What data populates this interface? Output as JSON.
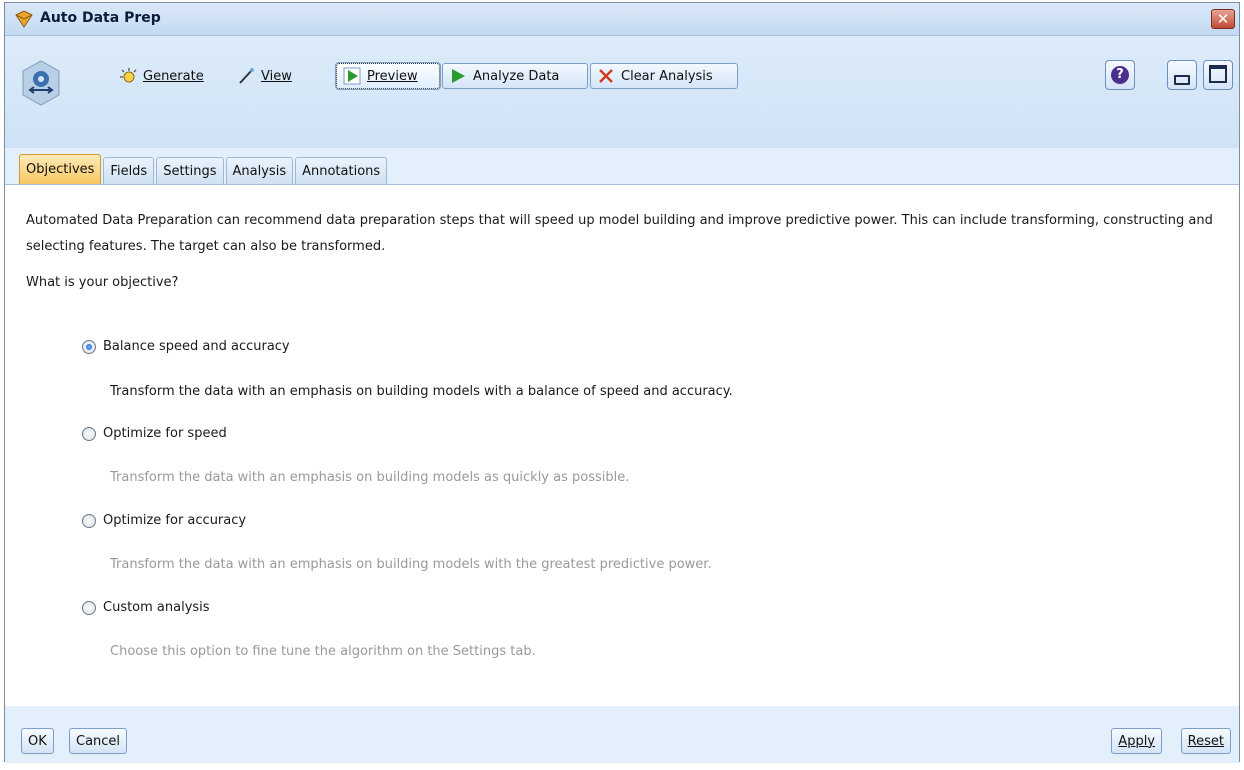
{
  "window": {
    "title": "Auto Data Prep",
    "close_glyph": "✕"
  },
  "toolbar": {
    "generate_label": "Generate",
    "view_label": "View",
    "preview_label": "Preview",
    "analyze_label": "Analyze Data",
    "clear_label": "Clear Analysis",
    "help_glyph": "?"
  },
  "tabs": [
    {
      "label": "Objectives",
      "active": true
    },
    {
      "label": "Fields"
    },
    {
      "label": "Settings"
    },
    {
      "label": "Analysis"
    },
    {
      "label": "Annotations"
    }
  ],
  "objectives": {
    "intro": "Automated Data Preparation can recommend data preparation steps that will speed up model building and improve predictive power. This can include transforming, constructing and selecting features. The target can also be transformed.",
    "question": "What is your objective?",
    "options": [
      {
        "label": "Balance speed and accuracy",
        "description": "Transform the data with an emphasis on building models with a balance of speed and accuracy.",
        "selected": true
      },
      {
        "label": "Optimize for speed",
        "description": "Transform the data with an emphasis on building models as quickly as possible.",
        "selected": false
      },
      {
        "label": "Optimize for accuracy",
        "description": "Transform the data with an emphasis on building models with the greatest predictive power.",
        "selected": false
      },
      {
        "label": "Custom analysis",
        "description": "Choose this option to fine tune the algorithm on the Settings tab.",
        "selected": false
      }
    ]
  },
  "footer": {
    "ok_label": "OK",
    "cancel_label": "Cancel",
    "apply_label": "Apply",
    "reset_label": "Reset"
  },
  "colors": {
    "accent": "#1b5fbf",
    "active_tab": "#f8c862",
    "window_bg": "#e3effa",
    "close": "#c24a35",
    "analyze_green": "#2e9a2e",
    "clear_red": "#d83a1e"
  },
  "icons": [
    "app-icon",
    "node-icon",
    "generate-icon",
    "view-icon",
    "preview-icon",
    "analyze-icon",
    "clear-icon",
    "help-icon",
    "minimize-icon",
    "maximize-icon",
    "close-icon"
  ]
}
